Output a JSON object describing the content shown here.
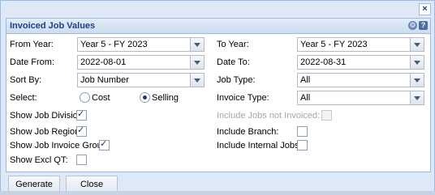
{
  "window": {
    "close_glyph": "×"
  },
  "panel": {
    "title": "Invoiced Job Values",
    "gear_glyph": "⚙",
    "help_glyph": "?"
  },
  "form": {
    "from_year": {
      "label": "From Year:",
      "value": "Year 5 - FY 2023"
    },
    "to_year": {
      "label": "To Year:",
      "value": "Year 5 - FY 2023"
    },
    "date_from": {
      "label": "Date From:",
      "value": "2022-08-01"
    },
    "date_to": {
      "label": "Date To:",
      "value": "2022-08-31"
    },
    "sort_by": {
      "label": "Sort By:",
      "value": "Job Number"
    },
    "job_type": {
      "label": "Job Type:",
      "value": "All"
    },
    "select": {
      "label": "Select:",
      "options": [
        {
          "label": "Cost",
          "selected": false
        },
        {
          "label": "Selling",
          "selected": true
        }
      ]
    },
    "invoice_type": {
      "label": "Invoice Type:",
      "value": "All"
    },
    "show_job_division": {
      "label": "Show Job Division:",
      "checked": true
    },
    "include_jobs_not_invoiced": {
      "label": "Include Jobs not Invoiced:",
      "checked": false,
      "disabled": true
    },
    "show_job_region": {
      "label": "Show Job Region:",
      "checked": true
    },
    "include_branch": {
      "label": "Include Branch:",
      "checked": false
    },
    "show_job_invoice_group": {
      "label": "Show Job Invoice Group:",
      "checked": true
    },
    "include_internal_jobs": {
      "label": "Include Internal Jobs:",
      "checked": false
    },
    "show_excl_qt": {
      "label": "Show Excl QT:",
      "checked": false
    }
  },
  "buttons": {
    "generate": "Generate",
    "close": "Close"
  },
  "check_glyph": "✓"
}
